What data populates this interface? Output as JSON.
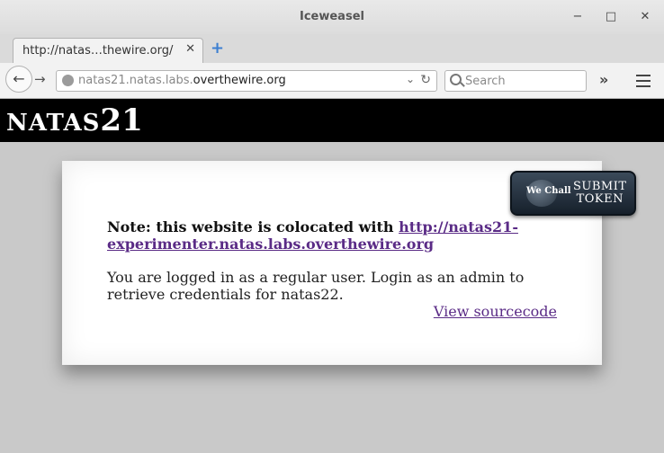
{
  "window": {
    "title": "Iceweasel",
    "minimize_glyph": "−",
    "maximize_glyph": "□",
    "close_glyph": "✕"
  },
  "tab": {
    "label": "http://natas…thewire.org/",
    "close_glyph": "✕"
  },
  "new_tab_glyph": "+",
  "nav": {
    "back_glyph": "←",
    "forward_glyph": "→",
    "url_prefix": "natas21.natas.labs.",
    "url_domain": "overthewire.org",
    "dropdown_glyph": "⌄",
    "reload_glyph": "↻",
    "search_placeholder": "Search",
    "overflow_glyph": "»"
  },
  "page": {
    "banner": {
      "prefix": "NATAS",
      "number": "21"
    },
    "note_label": "Note: this website is colocated with ",
    "note_link": "http://natas21-experimenter.natas.labs.overthewire.org",
    "message": "You are logged in as a regular user. Login as an admin to retrieve credentials for natas22.",
    "source_link": "View sourcecode",
    "token_button": {
      "brand": "We Chall",
      "line1": "Submit",
      "line2": "Token"
    }
  },
  "colors": {
    "banner_bg": "#000000",
    "link": "#5a2b86",
    "page_bg": "#c9c9c9",
    "newtab_accent": "#3c7fd1"
  }
}
